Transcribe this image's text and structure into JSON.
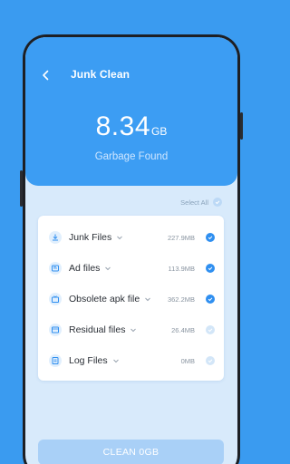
{
  "header": {
    "title": "Junk Clean",
    "size_value": "8.34",
    "size_unit": "GB",
    "subtitle": "Garbage Found"
  },
  "select_all": {
    "label": "Select All",
    "checked": false
  },
  "items": [
    {
      "label": "Junk Files",
      "size": "227.9MB",
      "checked": true,
      "icon": "download-icon"
    },
    {
      "label": "Ad files",
      "size": "113.9MB",
      "checked": true,
      "icon": "ad-icon"
    },
    {
      "label": "Obsolete apk file",
      "size": "362.2MB",
      "checked": true,
      "icon": "package-icon"
    },
    {
      "label": "Residual files",
      "size": "26.4MB",
      "checked": false,
      "icon": "folder-icon"
    },
    {
      "label": "Log Files",
      "size": "0MB",
      "checked": false,
      "icon": "document-icon"
    }
  ],
  "clean_button": {
    "label": "CLEAN 0GB"
  },
  "colors": {
    "background": "#3a9bf0",
    "header": "#3c9df3",
    "accent": "#2f8ff0",
    "screen_bg": "#d8eafb",
    "button_disabled": "#a9d0f7"
  }
}
